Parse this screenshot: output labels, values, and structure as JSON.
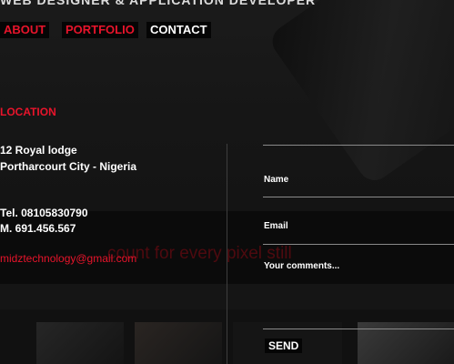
{
  "header": {
    "title": "WEB DESIGNER & APPLICATION DEVELOPER"
  },
  "nav": {
    "items": [
      {
        "label": "ABOUT"
      },
      {
        "label": "PORTFOLIO"
      },
      {
        "label": "CONTACT"
      }
    ]
  },
  "contact": {
    "heading": "LOCATION",
    "address_line1": "12 Royal lodge",
    "address_line2": "Portharcourt City - Nigeria",
    "tel": "Tel. 08105830790",
    "mobile": "M. 691.456.567",
    "email": "midztechnology@gmail.com",
    "background_text": "count for every pixel still"
  },
  "form": {
    "name_label": "Name",
    "email_label": "Email",
    "comments_label": "Your comments...",
    "send_label": "SEND"
  },
  "colors": {
    "accent": "#e8142b",
    "background": "#151515"
  }
}
